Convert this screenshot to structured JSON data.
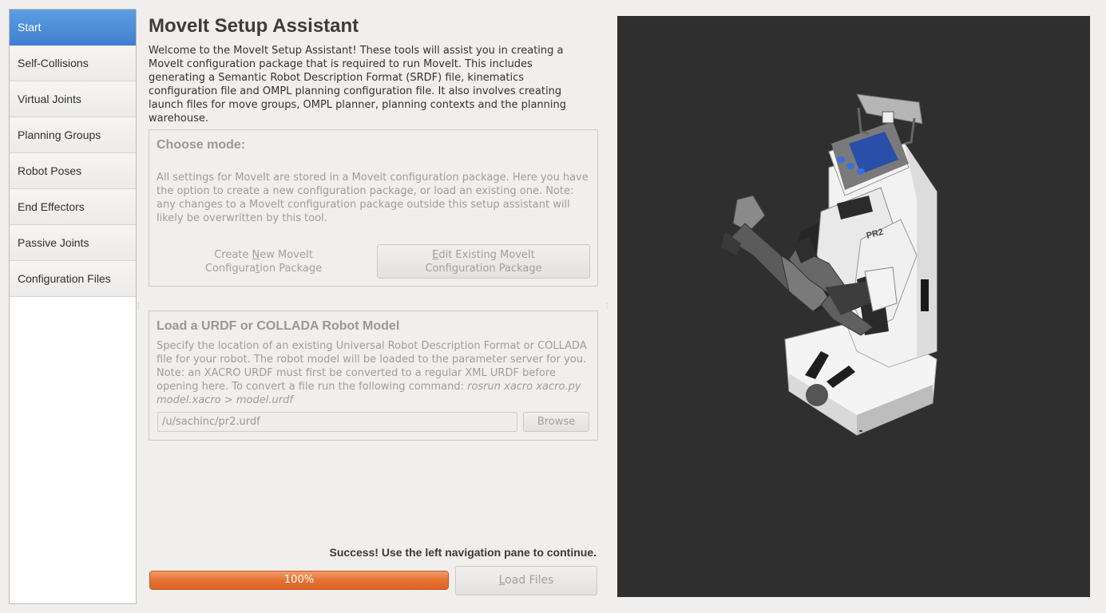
{
  "sidebar": {
    "items": [
      {
        "label": "Start"
      },
      {
        "label": "Self-Collisions"
      },
      {
        "label": "Virtual Joints"
      },
      {
        "label": "Planning Groups"
      },
      {
        "label": "Robot Poses"
      },
      {
        "label": "End Effectors"
      },
      {
        "label": "Passive Joints"
      },
      {
        "label": "Configuration Files"
      }
    ]
  },
  "main": {
    "title": "MoveIt Setup Assistant",
    "intro": "Welcome to the MoveIt Setup Assistant! These tools will assist you in creating a MoveIt configuration package that is required to run MoveIt. This includes generating a Semantic Robot Description Format (SRDF) file, kinematics configuration file and OMPL planning configuration file. It also involves creating launch files for move groups, OMPL planner, planning contexts and the planning warehouse."
  },
  "mode_box": {
    "title": "Choose mode:",
    "description": "All settings for MoveIt are stored in a Moveit configuration package. Here you have the option to create a new configuration package, or load an existing one. Note: any changes to a MoveIt configuration package outside this setup assistant will likely be overwritten by this tool.",
    "create_button": {
      "line1_pre": "Create ",
      "line1_mnemonic": "N",
      "line1_post": "ew MoveIt",
      "line2_pre": "Configura",
      "line2_mnemonic": "t",
      "line2_post": "ion Package"
    },
    "edit_button": {
      "line1_pre": "",
      "line1_mnemonic": "E",
      "line1_post": "dit Existing MoveIt",
      "line2": "Configuration Package"
    }
  },
  "load_box": {
    "title": "Load a URDF or COLLADA Robot Model",
    "description": "Specify the location of an existing Universal Robot Description Format or COLLADA file for your robot. The robot model will be loaded to the parameter server for you. Note: an XACRO URDF must first be converted to a regular XML URDF before opening here. To convert a file run the following command: ",
    "command": "rosrun xacro xacro.py model.xacro > model.urdf",
    "path_value": "/u/sachinc/pr2.urdf",
    "browse_label": "Browse"
  },
  "status": {
    "message": "Success! Use the left navigation pane to continue.",
    "progress_percent": 100,
    "progress_label": "100%",
    "load_button": {
      "mnemonic": "L",
      "rest": "oad Files"
    }
  },
  "colors": {
    "accent": "#4a8ad9",
    "progress": "#e4702f",
    "viewport_bg": "#2f2f2f"
  },
  "viewport": {
    "robot_label": "PR2"
  }
}
